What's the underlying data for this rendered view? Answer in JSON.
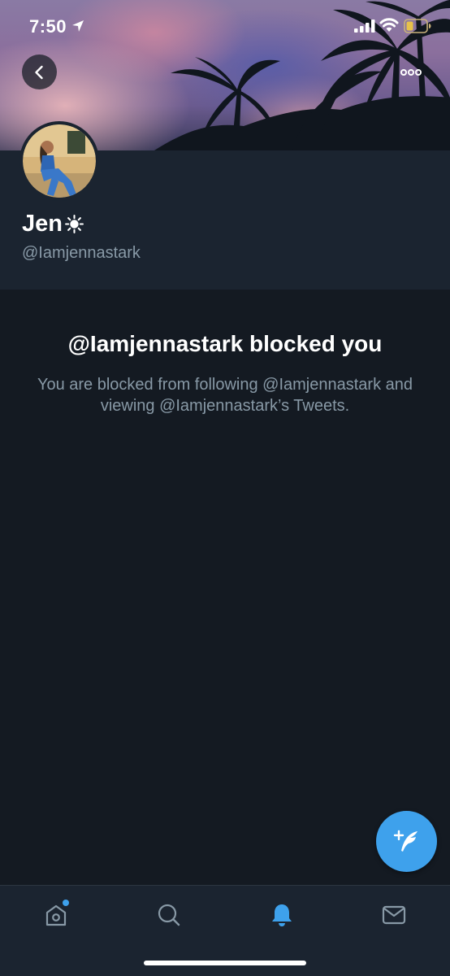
{
  "status_bar": {
    "time": "7:50"
  },
  "profile": {
    "display_name": "Jen",
    "handle": "@Iamjennastark"
  },
  "blocked": {
    "title": "@Iamjennastark blocked you",
    "body": "You are blocked from following @Iamjennastark and viewing @Iamjennastark’s Tweets."
  },
  "icons": {
    "back": "back-arrow-icon",
    "more": "more-options-icon",
    "compose": "compose-tweet-icon",
    "home": "home-icon",
    "search": "search-icon",
    "notifications": "notifications-bell-icon",
    "messages": "messages-envelope-icon"
  },
  "colors": {
    "background": "#141a22",
    "header_panel": "#1b2430",
    "accent": "#3ea1ec",
    "secondary_text": "#8899a6"
  }
}
